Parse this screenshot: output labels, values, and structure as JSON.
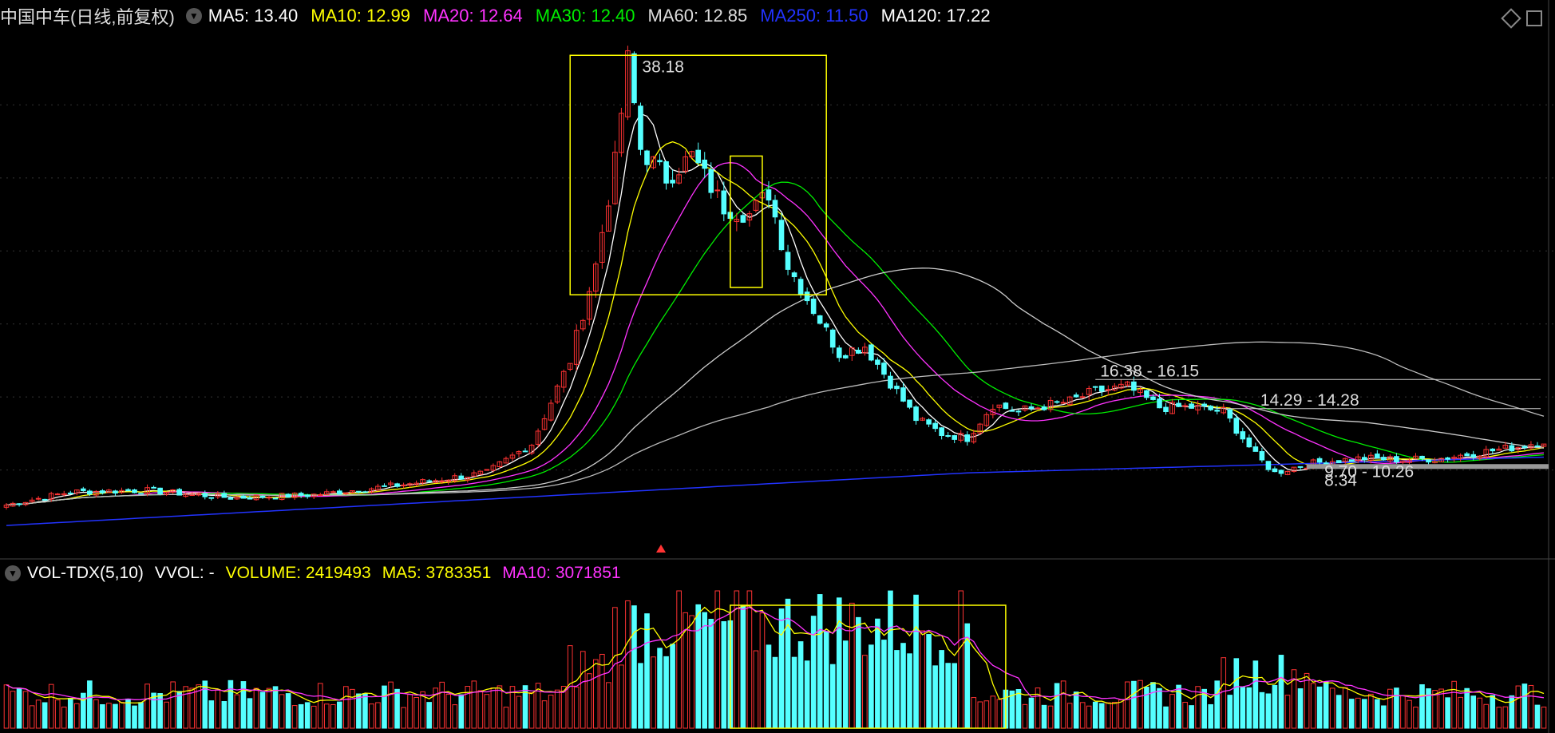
{
  "header": {
    "stock": "中国中车(日线,前复权)",
    "ma": [
      {
        "text": "MA5: 13.40",
        "color": "#ffffff"
      },
      {
        "text": "MA10: 12.99",
        "color": "#ffff00"
      },
      {
        "text": "MA20: 12.64",
        "color": "#ff33ff"
      },
      {
        "text": "MA30: 12.40",
        "color": "#00ee00"
      },
      {
        "text": "MA60: 12.85",
        "color": "#dddddd"
      },
      {
        "text": "MA250: 11.50",
        "color": "#2233ff"
      },
      {
        "text": "MA120: 17.22",
        "color": "#ffffff"
      }
    ]
  },
  "vol_header": {
    "label": "VOL-TDX(5,10)",
    "vvol": "VVOL: -",
    "volume": "VOLUME: 2419493",
    "ma5": "MA5: 3783351",
    "ma10": "MA10: 3071851"
  },
  "chart_data": {
    "type": "candlestick",
    "annotations": [
      {
        "text": "38.18"
      },
      {
        "text": "16.38 - 16.15"
      },
      {
        "text": "14.29 - 14.28"
      },
      {
        "text": "9.70 - 10.26"
      },
      {
        "text": "8.34"
      }
    ],
    "ylim": [
      5,
      40
    ],
    "colors": {
      "up": "#ff3333",
      "down": "#55ffff"
    }
  }
}
